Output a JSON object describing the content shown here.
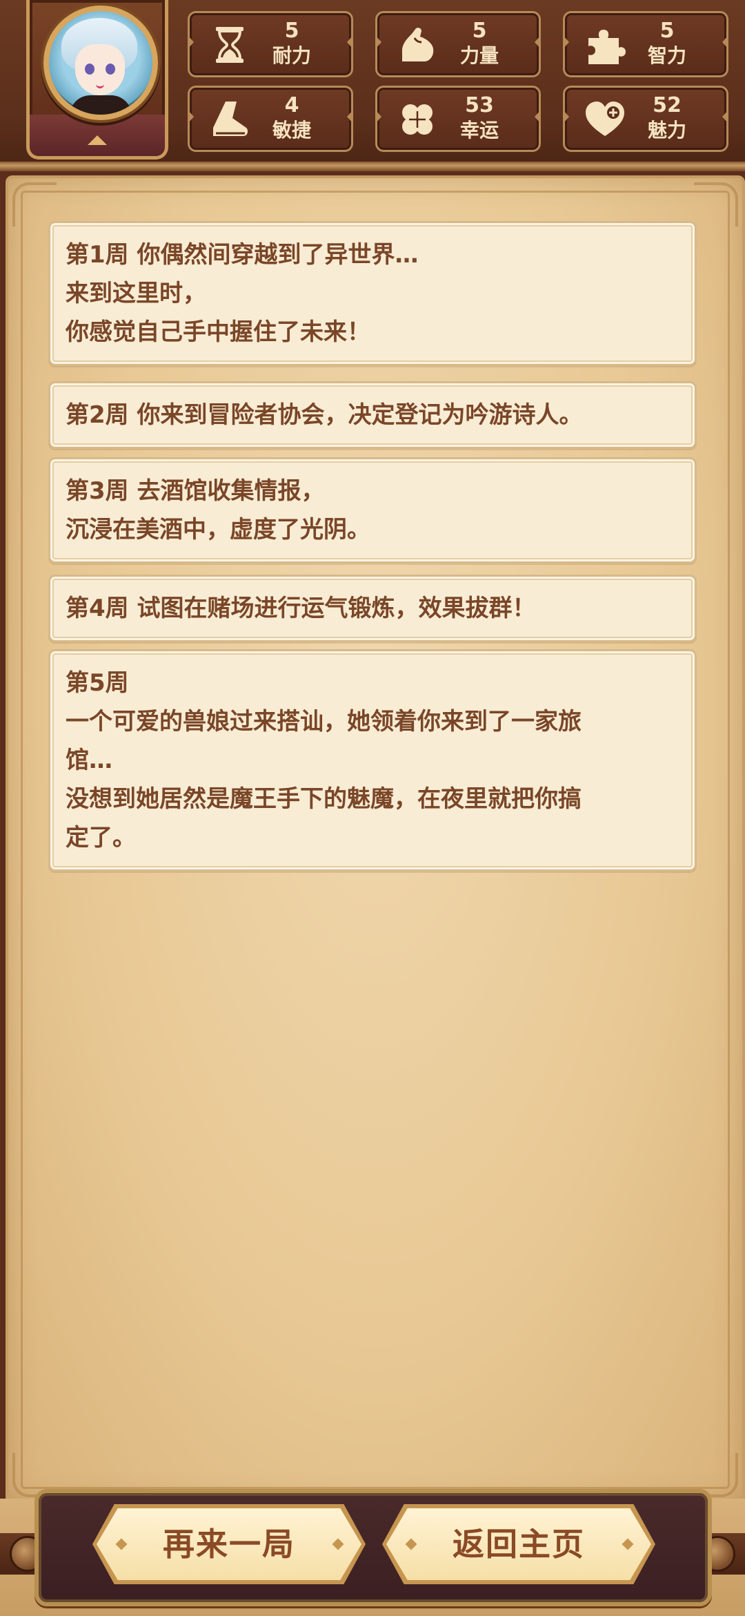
{
  "colors": {
    "header_bg": "#5b2f1b",
    "stat_text": "#f6e3c0",
    "parchment": "#e8c995",
    "event_text": "#7a4628",
    "button_text": "#8a4a26"
  },
  "stats": [
    {
      "icon": "hourglass-icon",
      "value": "5",
      "label": "耐力"
    },
    {
      "icon": "flexed-arm-icon",
      "value": "5",
      "label": "力量"
    },
    {
      "icon": "puzzle-piece-icon",
      "value": "5",
      "label": "智力"
    },
    {
      "icon": "boot-icon",
      "value": "4",
      "label": "敏捷"
    },
    {
      "icon": "four-leaf-clover-icon",
      "value": "53",
      "label": "幸运"
    },
    {
      "icon": "heart-plus-icon",
      "value": "52",
      "label": "魅力"
    }
  ],
  "events": [
    {
      "lines": [
        "第1周 你偶然间穿越到了异世界…",
        "来到这里时，",
        "你感觉自己手中握住了未来！"
      ]
    },
    {
      "lines": [
        "第2周 你来到冒险者协会，决定登记为吟游诗人。"
      ]
    },
    {
      "lines": [
        "第3周 去酒馆收集情报，",
        "沉浸在美酒中，虚度了光阴。"
      ]
    },
    {
      "lines": [
        "第4周 试图在赌场进行运气锻炼，效果拔群！"
      ]
    },
    {
      "lines": [
        "第5周",
        "一个可爱的兽娘过来搭讪，她领着你来到了一家旅",
        "馆…",
        "没想到她居然是魔王手下的魅魔，在夜里就把你搞",
        "定了。"
      ]
    }
  ],
  "buttons": {
    "retry_label": "再来一局",
    "home_label": "返回主页"
  }
}
